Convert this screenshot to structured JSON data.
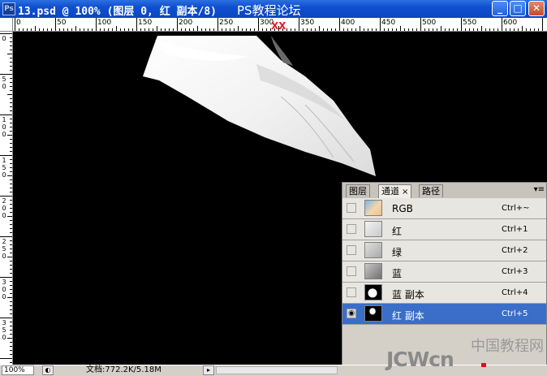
{
  "window": {
    "app_icon": "Ps",
    "title": "13.psd @ 100% (图层 0, 红 副本/8)",
    "overlay_title": "PS教程论坛",
    "overlay_mark": "XX",
    "minimize": "_",
    "maximize": "□",
    "close": "✕"
  },
  "ruler": {
    "top_labels": [
      "0",
      "50",
      "100",
      "150",
      "200",
      "250",
      "300",
      "350",
      "400",
      "450",
      "500",
      "550",
      "600"
    ],
    "left_labels": [
      [
        "0"
      ],
      [
        "5",
        "0"
      ],
      [
        "1",
        "0",
        "0"
      ],
      [
        "1",
        "5",
        "0"
      ],
      [
        "2",
        "0",
        "0"
      ],
      [
        "2",
        "5",
        "0"
      ],
      [
        "3",
        "0",
        "0"
      ],
      [
        "3",
        "5",
        "0"
      ]
    ]
  },
  "status": {
    "zoom": "100%",
    "doc_info": "文档:772.2K/5.18M",
    "arrow": "▸"
  },
  "panel": {
    "tabs": [
      "图层",
      "通道",
      "路径"
    ],
    "active_tab_close": "×",
    "menu_icon": "▾≡",
    "channels": [
      {
        "name": "RGB",
        "shortcut": "Ctrl+~",
        "visible": false,
        "selected": false,
        "thumb": "color"
      },
      {
        "name": "红",
        "shortcut": "Ctrl+1",
        "visible": false,
        "selected": false,
        "thumb": "gray-light"
      },
      {
        "name": "绿",
        "shortcut": "Ctrl+2",
        "visible": false,
        "selected": false,
        "thumb": "gray"
      },
      {
        "name": "蓝",
        "shortcut": "Ctrl+3",
        "visible": false,
        "selected": false,
        "thumb": "gray-dark"
      },
      {
        "name": "蓝 副本",
        "shortcut": "Ctrl+4",
        "visible": false,
        "selected": false,
        "thumb": "mask"
      },
      {
        "name": "红 副本",
        "shortcut": "Ctrl+5",
        "visible": true,
        "selected": true,
        "thumb": "mask-small"
      }
    ],
    "eye_glyph": "◉"
  },
  "watermark": {
    "cn": "中国教程网",
    "en": "JCWcn",
    "suffix": ".com"
  }
}
